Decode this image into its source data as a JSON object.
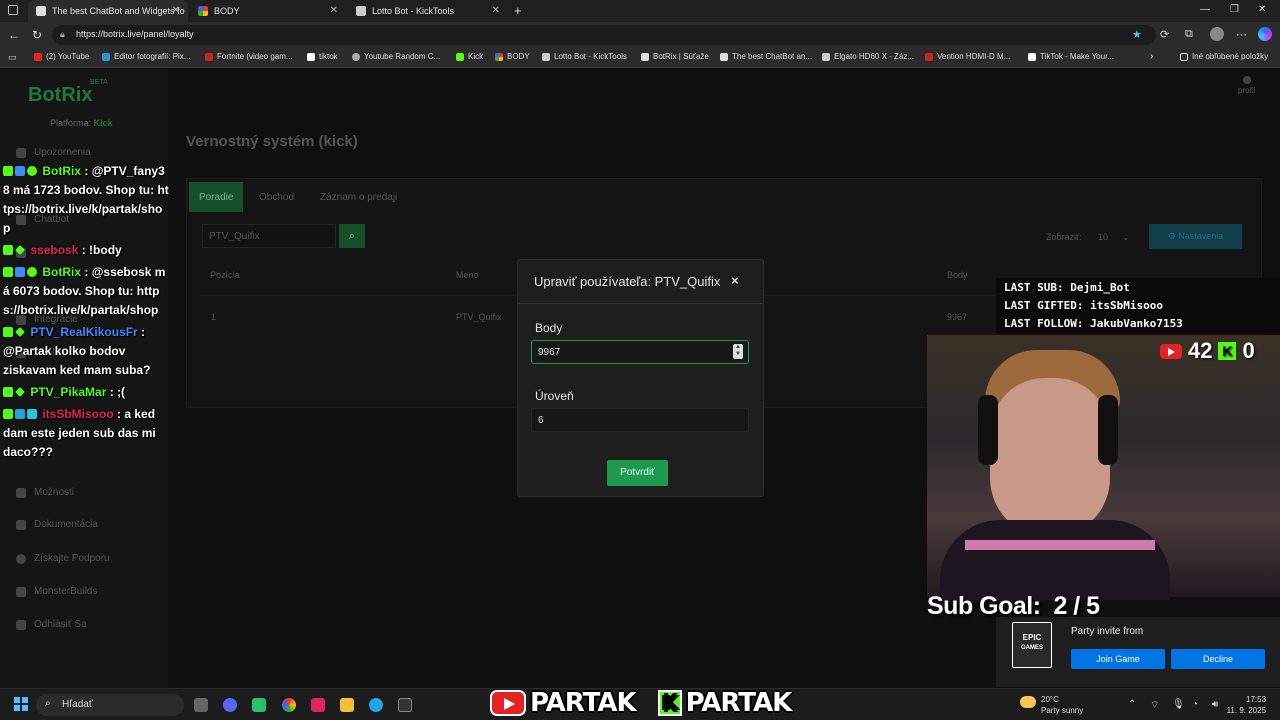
{
  "browser": {
    "tabs": [
      {
        "label": "The best ChatBot and Widgets fo",
        "active": true
      },
      {
        "label": "BODY",
        "active": false
      },
      {
        "label": "Lotto Bot - KickTools",
        "active": false
      }
    ],
    "new_tab": "+",
    "url": "https://botrix.live/panel/loyalty",
    "bookmarks": [
      "(2) YouTube",
      "Editor fotografií: Pix...",
      "Fortnite (video gam...",
      "tiktok",
      "Youtube Random C...",
      "Kick",
      "BODY",
      "Lotto Bot - KickTools",
      "BotRix | Súťaže",
      "The best ChatBot an...",
      "Elgato HD60 X - Záz...",
      "Vention HDMI-D M...",
      "TikTok - Make Your..."
    ],
    "other_bookmarks": "Iné obľúbené položky"
  },
  "app": {
    "logo": "BotRix",
    "beta": "BETA",
    "platform_label": "Platforma:",
    "platform_value": "Kick",
    "profile": "profil",
    "sidebar": [
      "Upozornenia",
      "Chatbot",
      "Profil",
      "Integrácie",
      "Minihry",
      "Možnosti",
      "Dokumentácia",
      "Získajte Podporu",
      "MonsterBuilds",
      "Odhlásiť Sa"
    ],
    "page_title": "Vernostný systém (kick)",
    "tabs": [
      "Poradie",
      "Obchod",
      "Záznam o predaji"
    ],
    "search_value": "PTV_Quifix",
    "show_label": "Zobraziť:",
    "show_value": "10",
    "settings_label": "Nastavenia",
    "table": {
      "headers": [
        "Pozícia",
        "Meno",
        "Body"
      ],
      "rows": [
        [
          "1",
          "PTV_Quifix",
          "9967"
        ]
      ]
    }
  },
  "modal": {
    "title": "Upraviť používateľa: PTV_Quifix",
    "body_label": "Body",
    "body_value": "9967",
    "level_label": "Úroveň",
    "level_value": "6",
    "confirm": "Potvrdiť"
  },
  "chat": [
    {
      "user": "BotRix",
      "color": "#53fc18",
      "text": "@PTV_fany38 má 1723 bodov. Shop tu: https://botrix.live/k/partak/shop"
    },
    {
      "user": "ssebosk",
      "color": "#e0245e",
      "text": "!body"
    },
    {
      "user": "BotRix",
      "color": "#53fc18",
      "text": "@ssebosk má 6073 bodov. Shop tu: https://botrix.live/k/partak/shop"
    },
    {
      "user": "PTV_RealKikousFr",
      "color": "#3c8cff",
      "text": "@Partak kolko bodov ziskavam ked mam suba?"
    },
    {
      "user": "PTV_PikaMar",
      "color": "#53fc18",
      "text": ";("
    },
    {
      "user": "itsSbMisooo",
      "color": "#e0245e",
      "text": "a ked dam este jeden sub das mi daco???"
    }
  ],
  "overlay": {
    "last_sub": "LAST SUB: Dejmi_Bot",
    "last_gifted": "LAST GIFTED: itsSbMisooo",
    "last_follow": "LAST FOLLOW: JakubVanko7153",
    "yt_count": "42",
    "kick_count": "0",
    "sub_goal": "Sub Goal:  2 / 5",
    "brand": "PARTAK"
  },
  "epic": {
    "logo_top": "EPIC",
    "logo_bottom": "GAMES",
    "invite": "Party invite from",
    "join": "Join Game",
    "decline": "Decline"
  },
  "taskbar": {
    "search": "Hľadať",
    "temp": "20°C",
    "weather": "Party sunny",
    "time": "17:53",
    "date": "11. 9. 2025"
  },
  "colors": {
    "brand_green": "#1e9a4e",
    "kick_green": "#53fc18",
    "youtube_red": "#e52222",
    "epic_blue": "#0074e4"
  }
}
